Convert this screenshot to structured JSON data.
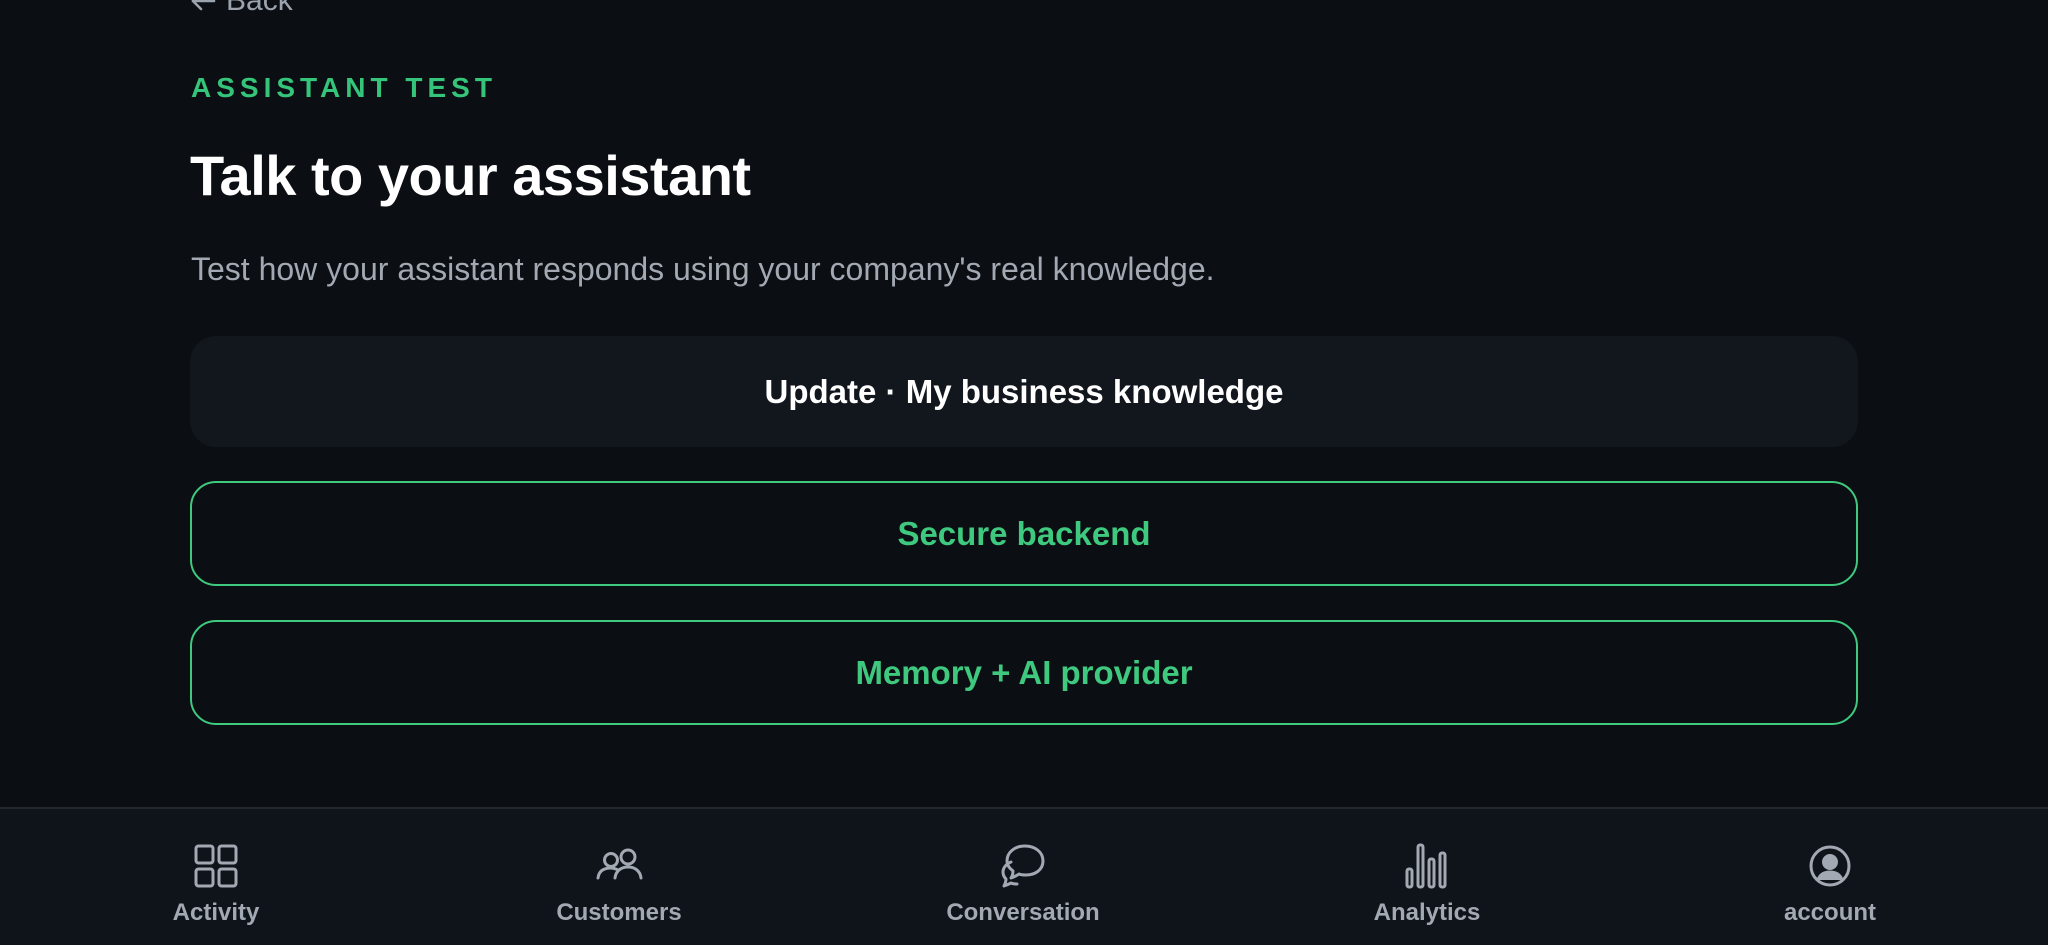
{
  "header": {
    "back_label": "Back",
    "eyebrow": "ASSISTANT TEST",
    "title": "Talk to your assistant",
    "subtitle": "Test how your assistant responds using your company's real knowledge."
  },
  "actions": {
    "update_label": "Update · My business knowledge",
    "secure_label": "Secure backend",
    "memory_label": "Memory + AI provider"
  },
  "bottom_nav": {
    "items": [
      {
        "label": "Activity",
        "icon": "grid-icon"
      },
      {
        "label": "Customers",
        "icon": "users-icon"
      },
      {
        "label": "Conversation",
        "icon": "chat-bubbles-icon"
      },
      {
        "label": "Analytics",
        "icon": "bar-chart-icon"
      },
      {
        "label": "account",
        "icon": "user-circle-icon"
      }
    ]
  },
  "colors": {
    "background": "#0b0e13",
    "accent_green": "#3ec97f",
    "text_primary": "#ffffff",
    "text_muted": "#a3a9b2",
    "nav_background": "#0f131a"
  }
}
